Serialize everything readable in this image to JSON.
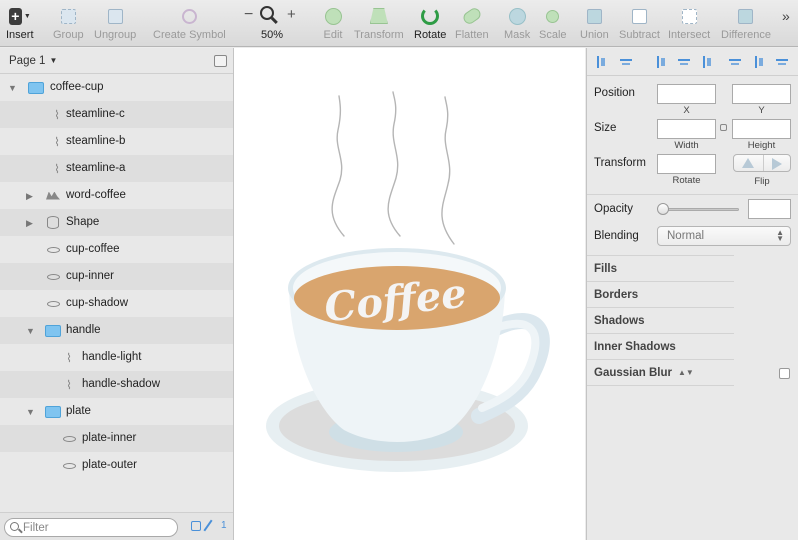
{
  "toolbar": {
    "insert": "Insert",
    "group": "Group",
    "ungroup": "Ungroup",
    "create_symbol": "Create Symbol",
    "zoom_out": "−",
    "zoom_in": "+",
    "zoom_level": "50%",
    "edit": "Edit",
    "transform": "Transform",
    "rotate": "Rotate",
    "flatten": "Flatten",
    "mask": "Mask",
    "scale": "Scale",
    "union": "Union",
    "subtract": "Subtract",
    "intersect": "Intersect",
    "difference": "Difference",
    "overflow": "»"
  },
  "page_selector": {
    "label": "Page 1",
    "caret": "▼"
  },
  "layers": [
    {
      "name": "coffee-cup",
      "icon": "folder-icon"
    },
    {
      "name": "steamline-c",
      "icon": "path-icon"
    },
    {
      "name": "steamline-b",
      "icon": "path-icon"
    },
    {
      "name": "steamline-a",
      "icon": "path-icon"
    },
    {
      "name": "word-coffee",
      "icon": "text-shape-icon"
    },
    {
      "name": "Shape",
      "icon": "shape-icon"
    },
    {
      "name": "cup-coffee",
      "icon": "oval-icon"
    },
    {
      "name": "cup-inner",
      "icon": "oval-icon"
    },
    {
      "name": "cup-shadow",
      "icon": "oval-icon"
    },
    {
      "name": "handle",
      "icon": "folder-icon"
    },
    {
      "name": "handle-light",
      "icon": "path-icon"
    },
    {
      "name": "handle-shadow",
      "icon": "path-icon"
    },
    {
      "name": "plate",
      "icon": "folder-icon"
    },
    {
      "name": "plate-inner",
      "icon": "oval-icon"
    },
    {
      "name": "plate-outer",
      "icon": "oval-icon"
    }
  ],
  "filter": {
    "placeholder": "Filter",
    "slice_count": "1"
  },
  "canvas": {
    "coffee_text": "Coffee"
  },
  "inspector": {
    "position": "Position",
    "x": "X",
    "y": "Y",
    "size": "Size",
    "width": "Width",
    "height": "Height",
    "transform": "Transform",
    "rotate": "Rotate",
    "flip": "Flip",
    "opacity": "Opacity",
    "blending": "Blending",
    "blending_value": "Normal",
    "sections": [
      "Fills",
      "Borders",
      "Shadows",
      "Inner Shadows",
      "Gaussian Blur"
    ]
  },
  "colors": {
    "accent": "#4a90d9",
    "coffee": "#d9a56e",
    "cup": "#eef4f7",
    "plate_outer": "#e7eff2",
    "plate_inner": "#dcdcdc",
    "steam": "#b5b5b5"
  }
}
